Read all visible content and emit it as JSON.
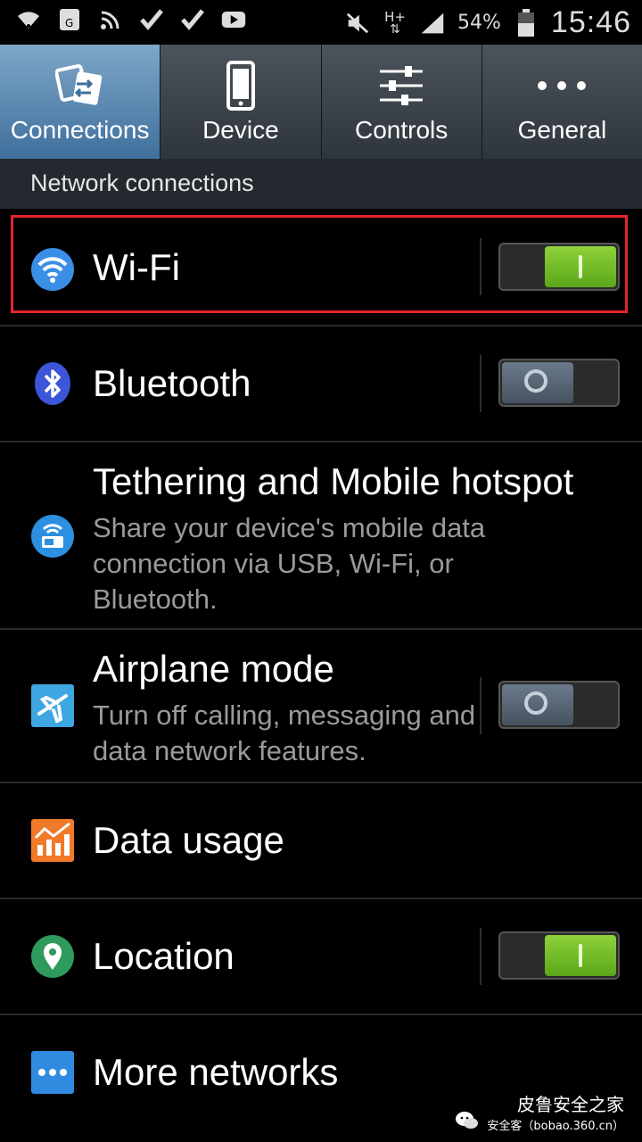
{
  "status_bar": {
    "battery_percent": "54%",
    "time": "15:46",
    "network_type": "H+"
  },
  "tabs": [
    {
      "label": "Connections",
      "icon": "connections-icon",
      "active": true
    },
    {
      "label": "Device",
      "icon": "phone-icon",
      "active": false
    },
    {
      "label": "Controls",
      "icon": "sliders-icon",
      "active": false
    },
    {
      "label": "General",
      "icon": "more-dots-icon",
      "active": false
    }
  ],
  "section": {
    "title": "Network connections"
  },
  "rows": {
    "wifi": {
      "title": "Wi-Fi",
      "toggle": "on"
    },
    "bluetooth": {
      "title": "Bluetooth",
      "toggle": "off"
    },
    "tethering": {
      "title": "Tethering and Mobile hotspot",
      "subtitle": "Share your device's mobile data connection via USB, Wi-Fi, or Bluetooth."
    },
    "airplane": {
      "title": "Airplane mode",
      "subtitle": "Turn off calling, messaging and data network features.",
      "toggle": "off"
    },
    "data_usage": {
      "title": "Data usage"
    },
    "location": {
      "title": "Location",
      "toggle": "on"
    },
    "more_networks": {
      "title": "More networks"
    }
  },
  "watermark": {
    "line1": "皮鲁安全之家",
    "line2": "安全客（bobao.360.cn）"
  },
  "colors": {
    "toggle_on": "#6fbf2a",
    "toggle_off": "#55626f",
    "highlight": "#e1262b",
    "active_tab": "#5a8bb8"
  }
}
